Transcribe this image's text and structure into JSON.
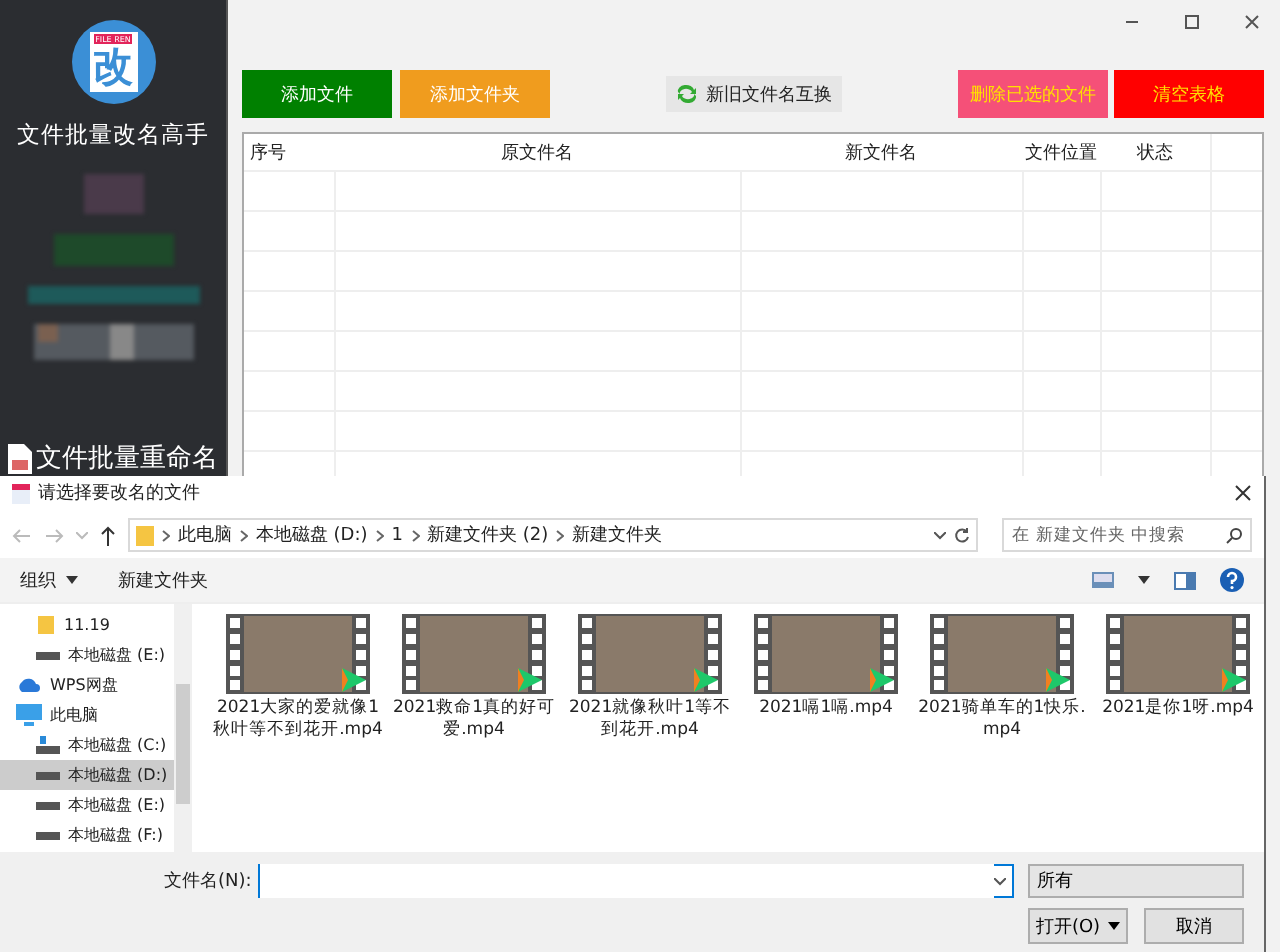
{
  "app": {
    "logo_badge": "FILE REN",
    "logo_char": "改",
    "title": "文件批量改名高手",
    "footer": "文件批量重命名"
  },
  "actions": [
    {
      "label": "添加文件",
      "kind": "solid",
      "color": "#008000"
    },
    {
      "label": "添加文件夹",
      "kind": "solid",
      "color": "#f09c1e"
    },
    {
      "label": "新旧文件名互换",
      "kind": "icon"
    },
    {
      "label": "删除已选的文件",
      "kind": "solid",
      "color": "#f55078"
    },
    {
      "label": "清空表格",
      "kind": "solid",
      "color": "#ff0000"
    }
  ],
  "table": {
    "columns": [
      "序号",
      "原文件名",
      "新文件名",
      "文件位置",
      "状态"
    ]
  },
  "dialog": {
    "title": "请选择要改名的文件",
    "path": [
      "此电脑",
      "本地磁盘 (D:)",
      "1",
      "新建文件夹 (2)",
      "新建文件夹"
    ],
    "search": {
      "placeholder": "在 新建文件夹 中搜索"
    },
    "organize": "组织",
    "new_folder": "新建文件夹",
    "nav": [
      {
        "label": "11.19",
        "kind": "folder",
        "selected": false
      },
      {
        "label": "本地磁盘 (E:)",
        "kind": "drive",
        "selected": false
      },
      {
        "label": "WPS网盘",
        "kind": "cloud",
        "selected": false
      },
      {
        "label": "此电脑",
        "kind": "computer",
        "selected": false,
        "children": [
          {
            "label": "本地磁盘 (C:)",
            "kind": "system-drive",
            "selected": false
          },
          {
            "label": "本地磁盘 (D:)",
            "kind": "drive",
            "selected": true
          },
          {
            "label": "本地磁盘 (E:)",
            "kind": "drive",
            "selected": false
          },
          {
            "label": "本地磁盘 (F:)",
            "kind": "drive",
            "selected": false
          }
        ]
      }
    ],
    "files": [
      {
        "name": "2021大家的爱就像1秋叶等不到花开.mp4"
      },
      {
        "name": "2021救命1真的好可爱.mp4"
      },
      {
        "name": "2021就像秋叶1等不到花开.mp4"
      },
      {
        "name": "2021嗝1嗝.mp4"
      },
      {
        "name": "2021骑单车的1快乐.mp4"
      },
      {
        "name": "2021是你1呀.mp4"
      }
    ],
    "filename_label": "文件名(N):",
    "filetype": "所有",
    "buttons": [
      "打开(O)",
      "取消"
    ]
  }
}
